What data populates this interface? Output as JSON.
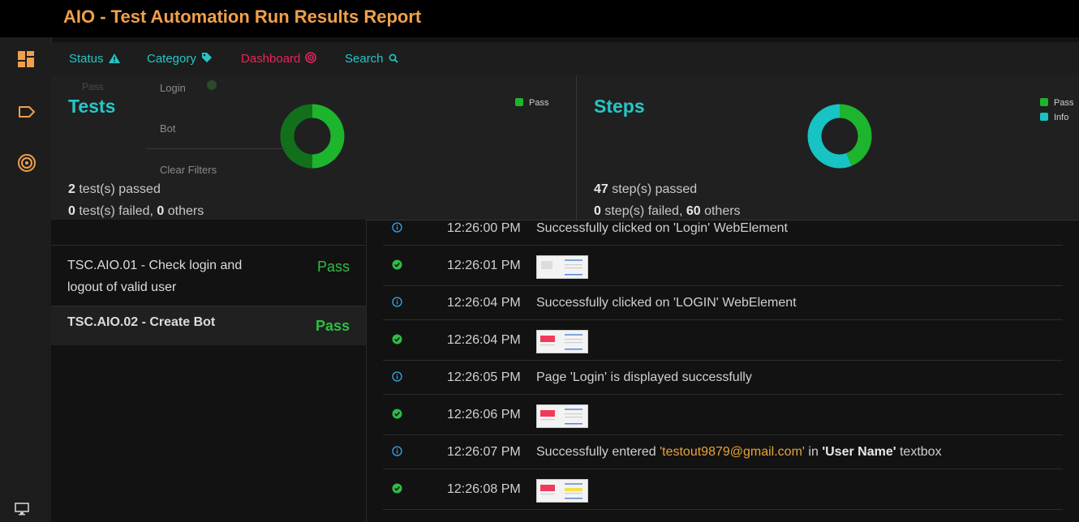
{
  "header": {
    "title": "AIO - Test Automation Run Results Report"
  },
  "sidebar": {
    "items": [
      {
        "icon": "dashboard-icon"
      },
      {
        "icon": "tag-icon"
      },
      {
        "icon": "target-icon"
      }
    ],
    "bottom_icon": "monitor-icon"
  },
  "nav": {
    "status_label": "Status",
    "category_label": "Category",
    "dashboard_label": "Dashboard",
    "search_label": "Search"
  },
  "dropdown": {
    "faded_label": "Pass",
    "items": [
      "Login",
      "Bot",
      "Clear Filters"
    ]
  },
  "dashboard": {
    "tests": {
      "title": "Tests",
      "legend": [
        {
          "label": "Pass",
          "color": "#1db52e"
        }
      ],
      "chart_data": {
        "type": "pie",
        "categories": [
          "Pass"
        ],
        "values": [
          2
        ]
      },
      "passed_count": "2",
      "passed_text": " test(s) passed",
      "failed_count": "0",
      "failed_text": " test(s) failed, ",
      "others_count": "0",
      "others_text": " others"
    },
    "steps": {
      "title": "Steps",
      "legend": [
        {
          "label": "Pass",
          "color": "#1db52e"
        },
        {
          "label": "Info",
          "color": "#17c3c3"
        }
      ],
      "chart_data": {
        "type": "pie",
        "categories": [
          "Pass",
          "Info"
        ],
        "values": [
          47,
          60
        ]
      },
      "passed_count": "47",
      "passed_text": " step(s) passed",
      "failed_count": "0",
      "failed_text": " step(s) failed, ",
      "others_count": "60",
      "others_text": " others"
    }
  },
  "tests": [
    {
      "name_line1": "TSC.AIO.01 - Check login and",
      "name_line2": "logout of valid user",
      "status": "Pass"
    },
    {
      "name_line1": "TSC.AIO.02 - Create Bot",
      "status": "Pass"
    }
  ],
  "logs": [
    {
      "type": "info",
      "time": "12:26:00 PM",
      "msg": "Successfully clicked on 'Login' WebElement"
    },
    {
      "type": "pass",
      "time": "12:26:01 PM"
    },
    {
      "type": "info",
      "time": "12:26:04 PM",
      "msg": "Successfully clicked on 'LOGIN' WebElement"
    },
    {
      "type": "pass",
      "time": "12:26:04 PM"
    },
    {
      "type": "info",
      "time": "12:26:05 PM",
      "msg": "Page 'Login' is displayed successfully"
    },
    {
      "type": "pass",
      "time": "12:26:06 PM"
    },
    {
      "type": "info",
      "time": "12:26:07 PM",
      "msg_pre": "Successfully entered ",
      "msg_hl": "'testout9879@gmail.com'",
      "msg_mid": " in ",
      "msg_bold": "'User Name'",
      "msg_post": " textbox"
    },
    {
      "type": "pass",
      "time": "12:26:08 PM"
    }
  ],
  "colors": {
    "accent": "#26c6c6",
    "brand": "#f0a04a",
    "pass": "#2ebd44",
    "info": "#3aa6e8",
    "dashboard": "#e8245a"
  }
}
